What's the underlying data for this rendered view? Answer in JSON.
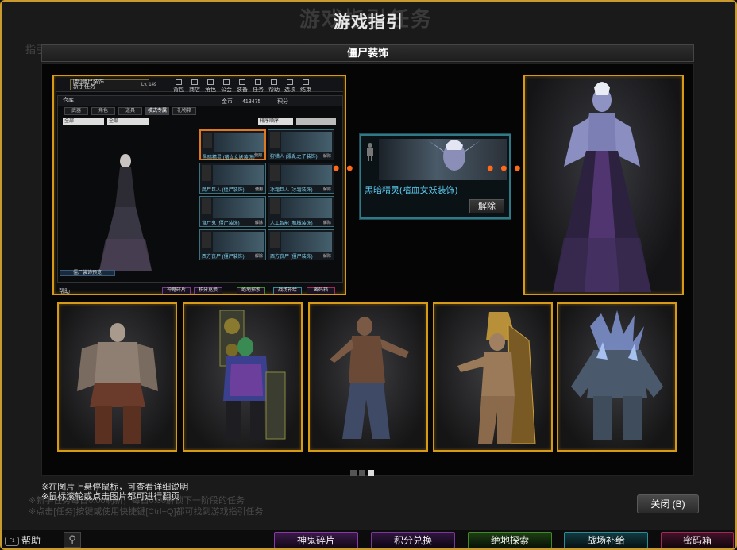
{
  "background": {
    "title": "游戏指引任务",
    "tab": "指引任务",
    "notes": [
      "※新手任务每日0:00刷新，每日0:00解锁下一阶段的任务",
      "※点击[任务]按键或使用快捷键[Ctrl+Q]都可找到游戏指引任务"
    ]
  },
  "dialog": {
    "title": "游戏指引",
    "section_title": "僵尸装饰"
  },
  "game_ui": {
    "player_line1": "[新]僵尸装饰",
    "player_line2": "新手任务",
    "level": "Lv. 149",
    "menu": [
      "背包",
      "商店",
      "角色",
      "公会",
      "装备",
      "任务",
      "帮助",
      "选项",
      "结束"
    ],
    "inventory_title": "仓库",
    "gold_label": "金币",
    "gold_value": "413475",
    "points_label": "积分",
    "tabs": [
      "武器",
      "角色",
      "道具",
      "模式专属",
      "礼物箱"
    ],
    "filter1": "全部",
    "filter2": "全部",
    "sort": "排序顺序",
    "items": [
      {
        "label": "黑暗精灵 (嗜血女妖装饰)",
        "action": "使用"
      },
      {
        "label": "狩猎人 (混乱之子装饰)",
        "action": "解除"
      },
      {
        "label": "腐尸巨人 (僵尸装饰)",
        "action": "使用"
      },
      {
        "label": "冰霜巨人 (冰霜装饰)",
        "action": "解除"
      },
      {
        "label": "食尸鬼 (僵尸装饰)",
        "action": "解除"
      },
      {
        "label": "人工智能 (机械装饰)",
        "action": "解除"
      },
      {
        "label": "西方丧尸 (僵尸装饰)",
        "action": "解除"
      },
      {
        "label": "西方丧尸 (僵尸装饰)",
        "action": "解除"
      }
    ],
    "preview_button": "僵尸装饰预览",
    "help": "帮助",
    "bottom": [
      "神鬼碎片",
      "积分兑换",
      "绝地探索",
      "战场补给",
      "密码箱"
    ]
  },
  "card": {
    "name": "黑暗精灵(嗜血女妖装饰)",
    "button": "解除"
  },
  "arrow": "• • • >",
  "thumbnails": [
    "meaty-zombie",
    "boombox-zombie",
    "ragged-zombie",
    "pharaoh-zombie",
    "crystal-golem"
  ],
  "pager": {
    "total": 3,
    "current": 3
  },
  "notes": [
    "※在图片上悬停鼠标，可查看详细说明",
    "※鼠标滚轮或点击图片都可进行翻页"
  ],
  "close_button": "关闭 (B)",
  "help_label": "帮助",
  "help_key": "F1",
  "bottom_bar": [
    {
      "label": "神鬼碎片",
      "color": "#8a3aa6"
    },
    {
      "label": "积分兑换",
      "color": "#7a3898"
    },
    {
      "label": "绝地探索",
      "color": "#3f8a2a"
    },
    {
      "label": "战场补给",
      "color": "#2f8c96"
    },
    {
      "label": "密码箱",
      "color": "#a02a54"
    }
  ]
}
